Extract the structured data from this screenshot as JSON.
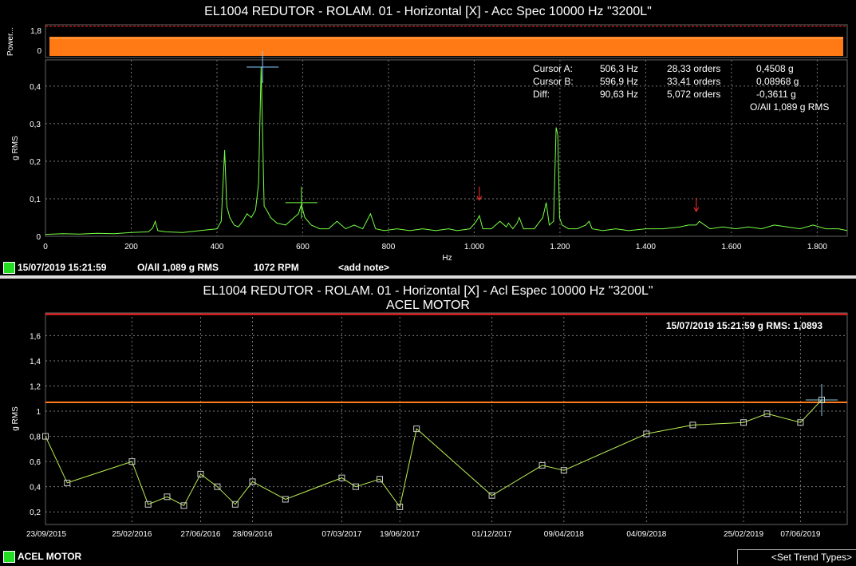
{
  "colors": {
    "spectrum": "#77ff44",
    "trend": "#bbee55",
    "alarm_red": "#ff2020",
    "alarm_orange": "#ff7a1a",
    "band": "#ff7a14",
    "grid": "#7a7a7a"
  },
  "top": {
    "title": "EL1004 REDUTOR - ROLAM. 01 - Horizontal [X] - Acc Spec 10000 Hz \"3200L\"",
    "power_label": "Power...",
    "power_ticks": [
      "1,8",
      "0"
    ],
    "cursor_info": [
      {
        "name": "Cursor A:",
        "hz": "506,3 Hz",
        "orders": "28,33 orders",
        "amp": "0,4508 g"
      },
      {
        "name": "Cursor B:",
        "hz": "596,9 Hz",
        "orders": "33,41 orders",
        "amp": "0,08968 g"
      },
      {
        "name": "Diff:",
        "hz": "90,63 Hz",
        "orders": "5,072 orders",
        "amp": "-0,3611 g"
      }
    ],
    "overall": "O/All 1,089 g RMS",
    "status": {
      "date": "15/07/2019 15:21:59",
      "overall": "O/All 1,089 g RMS",
      "rpm": "1072 RPM",
      "note": "<add note>"
    }
  },
  "bottom": {
    "title": "EL1004 REDUTOR - ROLAM. 01 - Horizontal [X] - Acl Espec 10000 Hz \"3200L\"",
    "subtitle": "ACEL MOTOR",
    "readout": "15/07/2019 15:21:59 g RMS: 1,0893",
    "status": {
      "name": "ACEL MOTOR",
      "button": "<Set Trend Types>"
    }
  },
  "chart_data": [
    {
      "type": "line",
      "xlabel": "Hz",
      "ylabel": "g RMS",
      "xlim": [
        0,
        1870
      ],
      "ylim": [
        0,
        0.47
      ],
      "x_ticks": [
        0,
        200,
        400,
        600,
        800,
        1000,
        1200,
        1400,
        1600,
        1800
      ],
      "x_tick_labels": [
        "0",
        "200",
        "400",
        "600",
        "800",
        "1.000",
        "1.200",
        "1.400",
        "1.600",
        "1.800"
      ],
      "y_ticks": [
        0,
        0.1,
        0.2,
        0.3,
        0.4
      ],
      "y_tick_labels": [
        "0",
        "0,1",
        "0,2",
        "0,3",
        "0,4"
      ],
      "grid": true,
      "series": [
        {
          "x": [
            0,
            40,
            80,
            120,
            160,
            200,
            240,
            250,
            256,
            262,
            280,
            320,
            360,
            400,
            410,
            418,
            423,
            430,
            440,
            450,
            460,
            470,
            480,
            490,
            497,
            503,
            506,
            510,
            516,
            525,
            540,
            560,
            580,
            590,
            597,
            605,
            620,
            640,
            660,
            680,
            700,
            720,
            740,
            758,
            770,
            790,
            820,
            850,
            880,
            910,
            940,
            960,
            990,
            1005,
            1012,
            1020,
            1040,
            1060,
            1075,
            1080,
            1090,
            1100,
            1105,
            1115,
            1140,
            1160,
            1168,
            1175,
            1185,
            1191,
            1195,
            1199,
            1205,
            1220,
            1240,
            1260,
            1268,
            1275,
            1300,
            1330,
            1360,
            1400,
            1440,
            1480,
            1500,
            1518,
            1525,
            1550,
            1580,
            1610,
            1640,
            1670,
            1700,
            1730,
            1760,
            1790,
            1820,
            1850,
            1870
          ],
          "y": [
            0.005,
            0.007,
            0.006,
            0.008,
            0.007,
            0.01,
            0.012,
            0.022,
            0.04,
            0.015,
            0.012,
            0.01,
            0.015,
            0.02,
            0.04,
            0.23,
            0.08,
            0.05,
            0.03,
            0.025,
            0.04,
            0.06,
            0.05,
            0.07,
            0.14,
            0.45,
            0.3,
            0.08,
            0.07,
            0.05,
            0.035,
            0.03,
            0.05,
            0.06,
            0.085,
            0.05,
            0.03,
            0.02,
            0.02,
            0.04,
            0.02,
            0.03,
            0.02,
            0.06,
            0.02,
            0.015,
            0.02,
            0.015,
            0.02,
            0.015,
            0.02,
            0.015,
            0.02,
            0.04,
            0.055,
            0.02,
            0.02,
            0.04,
            0.025,
            0.035,
            0.02,
            0.035,
            0.05,
            0.02,
            0.02,
            0.05,
            0.09,
            0.03,
            0.04,
            0.29,
            0.27,
            0.05,
            0.03,
            0.02,
            0.02,
            0.03,
            0.04,
            0.02,
            0.015,
            0.02,
            0.015,
            0.02,
            0.02,
            0.025,
            0.03,
            0.03,
            0.04,
            0.02,
            0.025,
            0.02,
            0.025,
            0.02,
            0.03,
            0.025,
            0.02,
            0.03,
            0.02,
            0.02,
            0.015
          ]
        }
      ],
      "cursors": [
        {
          "name": "A",
          "x": 506.3,
          "y": 0.4508
        },
        {
          "name": "B",
          "x": 596.9,
          "y": 0.08968
        }
      ],
      "markers": [
        {
          "x": 1012,
          "y": 0.09
        },
        {
          "x": 1518,
          "y": 0.06
        }
      ]
    },
    {
      "type": "line",
      "ylabel": "g RMS",
      "ylim": [
        0.1,
        1.78
      ],
      "y_ticks": [
        0.2,
        0.4,
        0.6,
        0.8,
        1.0,
        1.2,
        1.4,
        1.6
      ],
      "y_tick_labels": [
        "0,2",
        "0,4",
        "0,6",
        "0,8",
        "1",
        "1,2",
        "1,4",
        "1,6"
      ],
      "x_tick_labels": [
        "23/09/2015",
        "25/02/2016",
        "27/06/2016",
        "28/09/2016",
        "07/03/2017",
        "19/06/2017",
        "01/12/2017",
        "09/04/2018",
        "04/09/2018",
        "25/02/2019",
        "07/06/2019"
      ],
      "x_ticks": [
        "2015-09-23",
        "2016-02-25",
        "2016-06-27",
        "2016-09-28",
        "2017-03-07",
        "2017-06-19",
        "2017-12-01",
        "2018-04-09",
        "2018-09-04",
        "2019-02-25",
        "2019-06-07"
      ],
      "xlim": [
        "2015-09-23",
        "2019-07-15"
      ],
      "grid": true,
      "alarm_levels": [
        {
          "color": "red",
          "y": 1.77
        },
        {
          "color": "orange",
          "y": 1.07
        }
      ],
      "series": [
        {
          "name": "ACEL MOTOR",
          "x": [
            "2015-09-23",
            "2015-11-01",
            "2016-02-25",
            "2016-03-25",
            "2016-04-28",
            "2016-05-28",
            "2016-06-27",
            "2016-07-27",
            "2016-08-28",
            "2016-09-28",
            "2016-11-26",
            "2017-03-07",
            "2017-04-01",
            "2017-05-14",
            "2017-06-19",
            "2017-07-19",
            "2017-12-01",
            "2018-03-01",
            "2018-04-09",
            "2018-09-04",
            "2018-11-26",
            "2019-02-25",
            "2019-04-08",
            "2019-06-07",
            "2019-07-15"
          ],
          "y": [
            0.8,
            0.43,
            0.6,
            0.26,
            0.32,
            0.25,
            0.5,
            0.4,
            0.26,
            0.44,
            0.3,
            0.47,
            0.4,
            0.46,
            0.24,
            0.86,
            0.33,
            0.57,
            0.53,
            0.82,
            0.89,
            0.91,
            0.98,
            0.91,
            1.0893
          ]
        }
      ],
      "cursor": {
        "x": "2019-07-15",
        "y": 1.0893
      }
    }
  ]
}
